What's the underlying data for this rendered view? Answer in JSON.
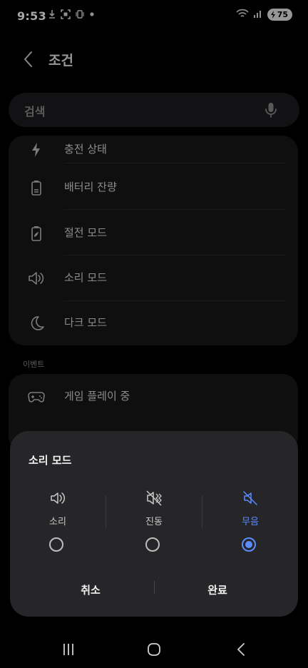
{
  "status_bar": {
    "time": "9:53",
    "battery_level": "75",
    "left_icons": [
      "download-icon",
      "screenshot-icon",
      "vibrate-icon",
      "dot-icon"
    ],
    "right_icons": [
      "wifi-icon",
      "signal-icon",
      "battery-icon"
    ]
  },
  "header": {
    "title": "조건"
  },
  "search": {
    "placeholder": "검색"
  },
  "conditions": {
    "items": [
      {
        "label": "충전 상태",
        "icon": "bolt-icon"
      },
      {
        "label": "배터리 잔량",
        "icon": "battery-icon"
      },
      {
        "label": "절전 모드",
        "icon": "power-saving-icon"
      },
      {
        "label": "소리 모드",
        "icon": "speaker-icon"
      },
      {
        "label": "다크 모드",
        "icon": "moon-icon"
      }
    ]
  },
  "events": {
    "section_label": "이벤트",
    "items": [
      {
        "label": "게임 플레이 중",
        "icon": "gamepad-icon"
      }
    ]
  },
  "sound_mode_dialog": {
    "title": "소리 모드",
    "options": [
      {
        "label": "소리",
        "icon": "speaker-icon",
        "selected": false
      },
      {
        "label": "진동",
        "icon": "vibrate-icon",
        "selected": false
      },
      {
        "label": "무음",
        "icon": "mute-icon",
        "selected": true
      }
    ],
    "cancel_label": "취소",
    "done_label": "완료"
  },
  "colors": {
    "accent": "#5b8cff",
    "background": "#000000",
    "card": "#17171a",
    "dialog": "#262629"
  }
}
